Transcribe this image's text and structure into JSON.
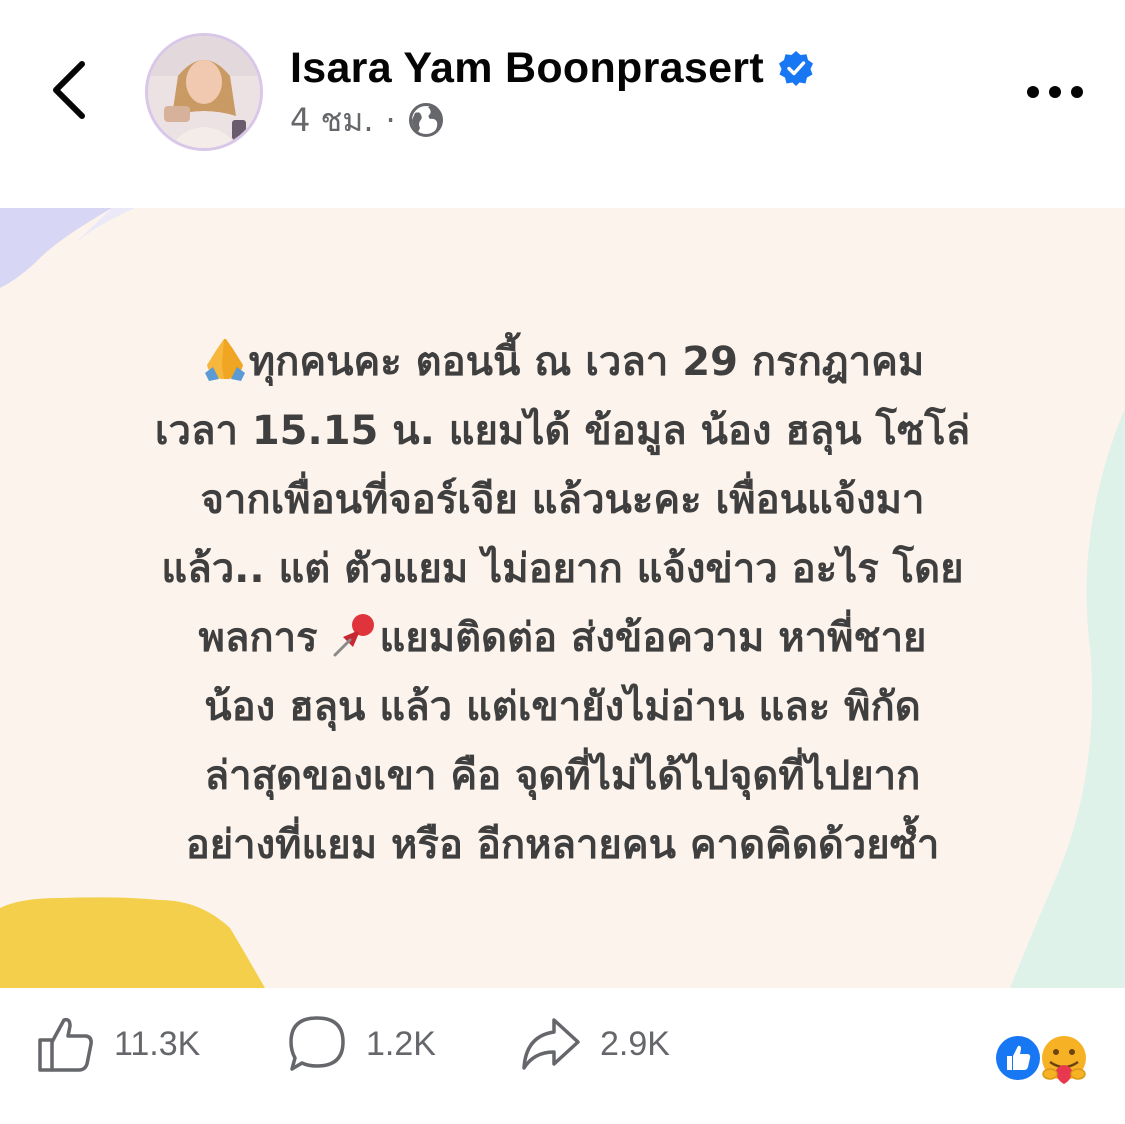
{
  "header": {
    "author_name": "Isara Yam Boonprasert",
    "timestamp": "4 ชม.",
    "separator": "·",
    "icons": {
      "back": "chevron-left-icon",
      "verified": "verified-badge-icon",
      "audience": "globe-icon",
      "more": "more-horizontal-icon"
    }
  },
  "post": {
    "background_color": "#fcf3ec",
    "lines": [
      "ทุกคนคะ ตอนนี้ ณ เวลา 29 กรกฎาคม",
      "เวลา  15.15 น. แยมได้ ข้อมูล น้อง ฮลุน โซโล่",
      "จากเพื่อนที่จอร์เจีย แล้วนะคะ เพื่อนแจ้งมา",
      "แล้ว.. แต่ ตัวแยม ไม่อยาก แจ้งข่าว อะไร โดย",
      "พลการ",
      "แยมติดต่อ ส่งข้อความ หาพี่ชาย",
      "น้อง ฮลุน แล้ว แต่เขายังไม่อ่าน และ พิกัด",
      "ล่าสุดของเขา คือ จุดที่ไม่ได้ไปจุดที่ไปยาก",
      "อย่างที่แยม หรือ อีกหลายคน คาดคิดด้วยซ้ำ"
    ],
    "emojis": {
      "first": "folded-hands-icon",
      "second": "pushpin-icon"
    }
  },
  "actions": {
    "like": {
      "count": "11.3K",
      "icon": "thumbs-up-icon"
    },
    "comment": {
      "count": "1.2K",
      "icon": "comment-icon"
    },
    "share": {
      "count": "2.9K",
      "icon": "share-icon"
    },
    "reactions": [
      "like-reaction-icon",
      "care-reaction-icon"
    ]
  },
  "colors": {
    "accent_blue": "#1877f2",
    "text_secondary": "#65676b",
    "post_text": "#3f3f3f"
  }
}
